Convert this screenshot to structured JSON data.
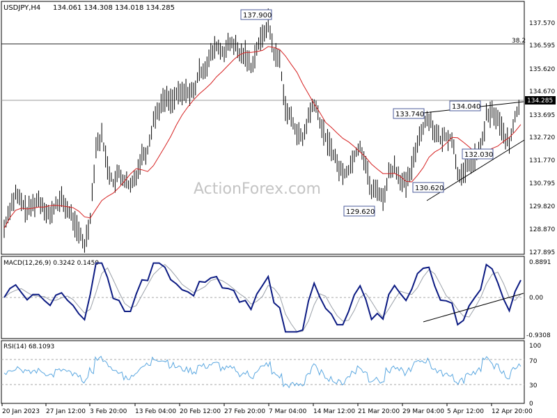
{
  "chart_data": [
    {
      "type": "candlestick",
      "title": "USDJPY,H4",
      "ohlc_label": "134.061 134.308 134.018 134.285",
      "ylim": [
        127.895,
        138.7
      ],
      "yticks": [
        "137.570",
        "136.595",
        "135.620",
        "134.670",
        "133.695",
        "132.720",
        "131.770",
        "130.795",
        "129.820",
        "128.870",
        "127.895"
      ],
      "current_price": "134.285",
      "fib_level": {
        "label": "38.2",
        "value": 136.78
      },
      "price_labels": [
        "137.900",
        "133.740",
        "134.040",
        "132.030",
        "130.620",
        "129.620"
      ],
      "watermark": "ActionForex.com",
      "close": [
        128.9,
        129.8,
        130.3,
        130.0,
        129.6,
        129.9,
        130.1,
        129.8,
        129.4,
        129.9,
        130.1,
        129.7,
        129.3,
        128.7,
        128.2,
        129.4,
        132.4,
        132.8,
        131.5,
        130.8,
        131.2,
        130.9,
        130.6,
        131.2,
        132.0,
        132.2,
        133.5,
        134.0,
        134.4,
        134.3,
        134.5,
        134.6,
        134.7,
        134.6,
        135.5,
        135.7,
        136.2,
        136.6,
        136.3,
        136.6,
        136.7,
        136.2,
        136.3,
        135.7,
        136.5,
        137.0,
        137.6,
        136.3,
        136.0,
        134.0,
        133.5,
        133.0,
        132.6,
        133.6,
        134.2,
        133.4,
        132.7,
        132.3,
        131.6,
        131.2,
        131.4,
        132.0,
        132.4,
        131.6,
        130.4,
        130.6,
        130.1,
        131.2,
        131.5,
        131.0,
        130.7,
        131.4,
        132.6,
        133.2,
        133.6,
        133.0,
        132.6,
        132.8,
        132.7,
        131.3,
        131.1,
        131.6,
        131.9,
        132.2,
        133.6,
        133.8,
        133.5,
        132.9,
        132.4,
        133.6,
        134.285
      ]
    },
    {
      "type": "line",
      "title": "MACD(12,26,9) 0.3242 0.1459",
      "yticks": [
        "0.8891",
        "0.00",
        "-0.9308"
      ]
    },
    {
      "type": "line",
      "title": "RSI(14) 68.1093",
      "yticks": [
        "100",
        "70",
        "30",
        "0"
      ]
    }
  ],
  "xaxis": {
    "labels": [
      "20 Jan 2023",
      "27 Jan 12:00",
      "3 Feb 20:00",
      "13 Feb 04:00",
      "20 Feb 12:00",
      "27 Feb 20:00",
      "7 Mar 04:00",
      "14 Mar 12:00",
      "21 Mar 20:00",
      "29 Mar 04:00",
      "5 Apr 12:00",
      "12 Apr 20:00"
    ]
  },
  "colors": {
    "candle": "#000000",
    "ma": "#d62020",
    "macd": "#0b1a82",
    "signal": "#9aa0a8",
    "rsi": "#5aa7e0"
  }
}
